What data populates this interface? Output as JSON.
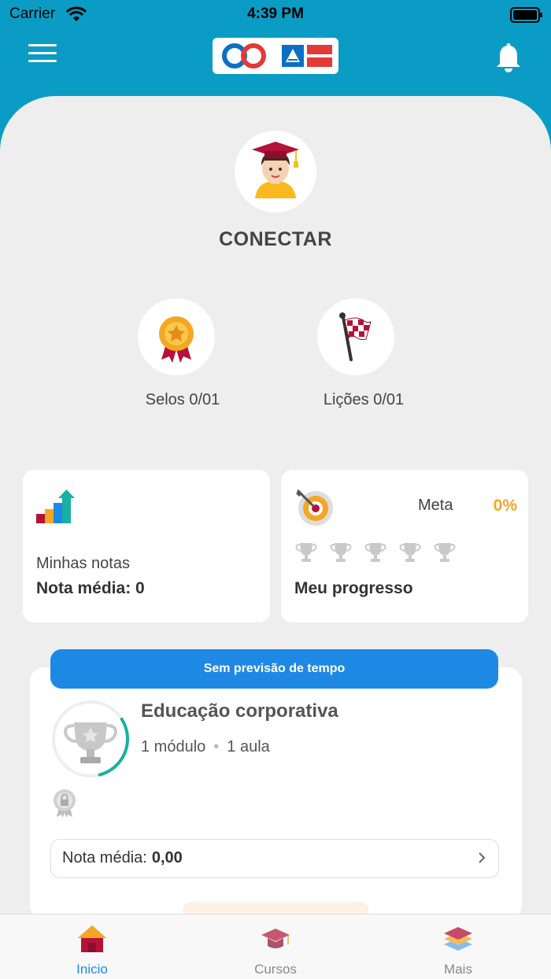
{
  "status_bar": {
    "carrier": "Carrier",
    "time": "4:39 PM"
  },
  "profile": {
    "name": "CONECTAR"
  },
  "stats": {
    "selos": "Selos 0/01",
    "licoes": "Lições 0/01"
  },
  "grades_card": {
    "title": "Minhas notas",
    "average": "Nota média: 0"
  },
  "progress_card": {
    "meta_label": "Meta",
    "meta_value": "0%",
    "title": "Meu progresso",
    "trophies_total": 5,
    "trophies_earned": 0
  },
  "course": {
    "time_label": "Sem previsão de tempo",
    "title": "Educação corporativa",
    "modules": "1 módulo",
    "lessons": "1 aula",
    "grade_label": "Nota média:",
    "grade_value": "0,00",
    "progress": 0.3
  },
  "tabs": [
    {
      "label": "Inicio",
      "active": true
    },
    {
      "label": "Cursos",
      "active": false
    },
    {
      "label": "Mais",
      "active": false
    }
  ],
  "colors": {
    "header": "#0a9cc4",
    "accent": "#1e88e5",
    "meta": "#f5a623",
    "ring": "#18b0a3"
  }
}
